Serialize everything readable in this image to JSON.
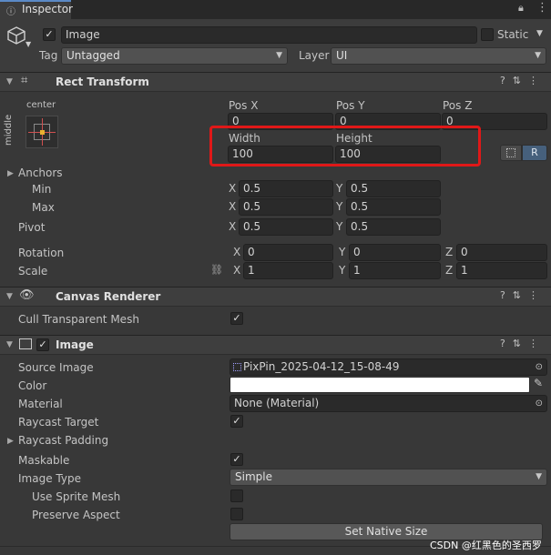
{
  "tab": {
    "title": "Inspector"
  },
  "object": {
    "name": "Image",
    "static_label": "Static",
    "tag_label": "Tag",
    "tag_value": "Untagged",
    "layer_label": "Layer",
    "layer_value": "UI"
  },
  "rect_transform": {
    "title": "Rect Transform",
    "anchor_preset_h": "center",
    "anchor_preset_v": "middle",
    "pos_x_label": "Pos X",
    "pos_y_label": "Pos Y",
    "pos_z_label": "Pos Z",
    "pos_x": "0",
    "pos_y": "0",
    "pos_z": "0",
    "width_label": "Width",
    "height_label": "Height",
    "width": "100",
    "height": "100",
    "raw_button": "R",
    "anchors_label": "Anchors",
    "min_label": "Min",
    "max_label": "Max",
    "min_x": "0.5",
    "min_y": "0.5",
    "max_x": "0.5",
    "max_y": "0.5",
    "pivot_label": "Pivot",
    "pivot_x": "0.5",
    "pivot_y": "0.5",
    "rotation_label": "Rotation",
    "rot_x": "0",
    "rot_y": "0",
    "rot_z": "0",
    "scale_label": "Scale",
    "scale_x": "1",
    "scale_y": "1",
    "scale_z": "1",
    "x": "X",
    "y": "Y",
    "z": "Z"
  },
  "canvas_renderer": {
    "title": "Canvas Renderer",
    "cull_label": "Cull Transparent Mesh"
  },
  "image": {
    "title": "Image",
    "source_image_label": "Source Image",
    "source_image_value": "PixPin_2025-04-12_15-08-49",
    "color_label": "Color",
    "color_value": "#ffffff",
    "material_label": "Material",
    "material_value": "None (Material)",
    "raycast_target_label": "Raycast Target",
    "raycast_padding_label": "Raycast Padding",
    "maskable_label": "Maskable",
    "image_type_label": "Image Type",
    "image_type_value": "Simple",
    "use_sprite_mesh_label": "Use Sprite Mesh",
    "preserve_aspect_label": "Preserve Aspect",
    "set_native_size": "Set Native Size"
  },
  "watermark": "CSDN @红黑色的圣西罗",
  "colors": {
    "highlight": "#e01818",
    "accent_r": "#46607c"
  }
}
